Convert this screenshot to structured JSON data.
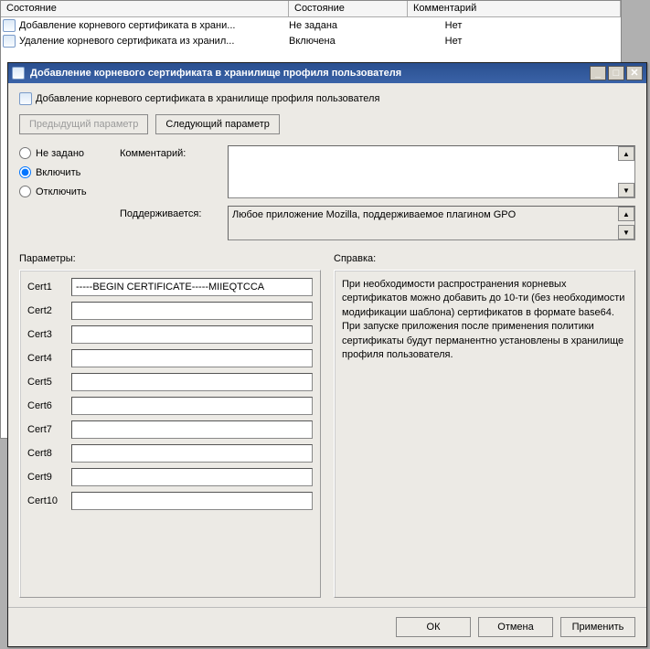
{
  "bgTable": {
    "headers": [
      "Состояние",
      "Состояние",
      "Комментарий"
    ],
    "rows": [
      {
        "name": "Добавление корневого сертификата в храни...",
        "state": "Не задана",
        "comment": "Нет"
      },
      {
        "name": "Удаление корневого сертификата из хранил...",
        "state": "Включена",
        "comment": "Нет"
      }
    ]
  },
  "dialog": {
    "title": "Добавление корневого сертификата в хранилище профиля пользователя",
    "subtitle": "Добавление корневого сертификата в хранилище профиля пользователя",
    "prevBtn": "Предыдущий параметр",
    "nextBtn": "Следующий параметр",
    "radios": {
      "notSet": "Не задано",
      "enable": "Включить",
      "disable": "Отключить"
    },
    "commentLabel": "Комментарий:",
    "supportedLabel": "Поддерживается:",
    "supportedText": "Любое приложение Mozilla, поддерживаемое плагином GPO",
    "paramsLabel": "Параметры:",
    "helpLabel": "Справка:",
    "certs": [
      {
        "label": "Cert1",
        "value": "-----BEGIN CERTIFICATE-----MIIEQTCCA"
      },
      {
        "label": "Cert2",
        "value": ""
      },
      {
        "label": "Cert3",
        "value": ""
      },
      {
        "label": "Cert4",
        "value": ""
      },
      {
        "label": "Cert5",
        "value": ""
      },
      {
        "label": "Cert6",
        "value": ""
      },
      {
        "label": "Cert7",
        "value": ""
      },
      {
        "label": "Cert8",
        "value": ""
      },
      {
        "label": "Cert9",
        "value": ""
      },
      {
        "label": "Cert10",
        "value": ""
      }
    ],
    "helpText": "При необходимости распространения корневых сертификатов можно добавить до 10-ти (без необходимости модификации шаблона) сертификатов в формате base64. При запуске приложения после применения политики сертификаты будут перманентно установлены в хранилище профиля пользователя.",
    "okBtn": "ОК",
    "cancelBtn": "Отмена",
    "applyBtn": "Применить"
  }
}
